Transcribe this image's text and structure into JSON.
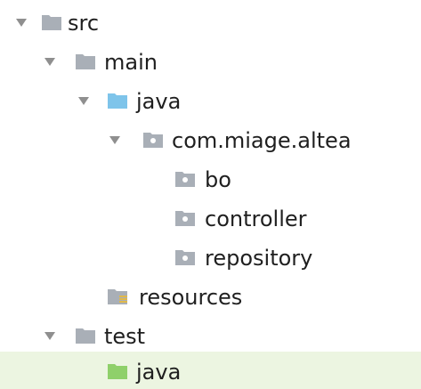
{
  "tree": {
    "nodes": [
      {
        "label": "src",
        "icon": "folder-icon",
        "expanded": true
      },
      {
        "label": "main",
        "icon": "folder-icon",
        "expanded": true
      },
      {
        "label": "java",
        "icon": "source-folder-icon",
        "expanded": true
      },
      {
        "label": "com.miage.altea",
        "icon": "package-icon",
        "expanded": true
      },
      {
        "label": "bo",
        "icon": "package-icon"
      },
      {
        "label": "controller",
        "icon": "package-icon"
      },
      {
        "label": "repository",
        "icon": "package-icon"
      },
      {
        "label": "resources",
        "icon": "resources-folder-icon"
      },
      {
        "label": "test",
        "icon": "folder-icon",
        "expanded": true
      },
      {
        "label": "java",
        "icon": "test-source-folder-icon",
        "selected": true
      }
    ]
  },
  "colors": {
    "folder": "#a9afb7",
    "source_folder": "#7ec4ea",
    "test_source_folder": "#8fd06a",
    "resources_stripe": "#e0b84a",
    "selection": "#ecf5e1",
    "arrow": "#8f8f8f"
  }
}
